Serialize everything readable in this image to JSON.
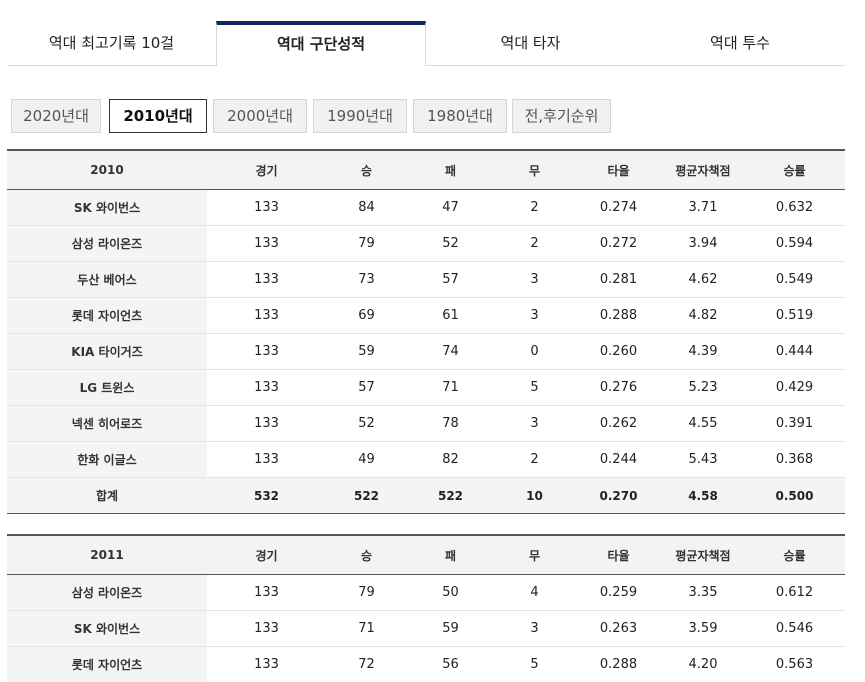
{
  "main_tabs": [
    {
      "label": "역대 최고기록 10걸",
      "active": false
    },
    {
      "label": "역대 구단성적",
      "active": true
    },
    {
      "label": "역대 타자",
      "active": false
    },
    {
      "label": "역대 투수",
      "active": false
    }
  ],
  "decades": [
    {
      "label": "2020년대",
      "active": false
    },
    {
      "label": "2010년대",
      "active": true
    },
    {
      "label": "2000년대",
      "active": false
    },
    {
      "label": "1990년대",
      "active": false
    },
    {
      "label": "1980년대",
      "active": false
    },
    {
      "label": "전,후기순위",
      "active": false
    }
  ],
  "columns": [
    "경기",
    "승",
    "패",
    "무",
    "타율",
    "평균자책점",
    "승률"
  ],
  "tables": [
    {
      "year": "2010",
      "rows": [
        [
          "SK 와이번스",
          "133",
          "84",
          "47",
          "2",
          "0.274",
          "3.71",
          "0.632"
        ],
        [
          "삼성 라이온즈",
          "133",
          "79",
          "52",
          "2",
          "0.272",
          "3.94",
          "0.594"
        ],
        [
          "두산 베어스",
          "133",
          "73",
          "57",
          "3",
          "0.281",
          "4.62",
          "0.549"
        ],
        [
          "롯데 자이언츠",
          "133",
          "69",
          "61",
          "3",
          "0.288",
          "4.82",
          "0.519"
        ],
        [
          "KIA 타이거즈",
          "133",
          "59",
          "74",
          "0",
          "0.260",
          "4.39",
          "0.444"
        ],
        [
          "LG 트윈스",
          "133",
          "57",
          "71",
          "5",
          "0.276",
          "5.23",
          "0.429"
        ],
        [
          "넥센 히어로즈",
          "133",
          "52",
          "78",
          "3",
          "0.262",
          "4.55",
          "0.391"
        ],
        [
          "한화 이글스",
          "133",
          "49",
          "82",
          "2",
          "0.244",
          "5.43",
          "0.368"
        ]
      ],
      "total": [
        "합계",
        "532",
        "522",
        "522",
        "10",
        "0.270",
        "4.58",
        "0.500"
      ]
    },
    {
      "year": "2011",
      "rows": [
        [
          "삼성 라이온즈",
          "133",
          "79",
          "50",
          "4",
          "0.259",
          "3.35",
          "0.612"
        ],
        [
          "SK 와이번스",
          "133",
          "71",
          "59",
          "3",
          "0.263",
          "3.59",
          "0.546"
        ],
        [
          "롯데 자이언츠",
          "133",
          "72",
          "56",
          "5",
          "0.288",
          "4.20",
          "0.563"
        ]
      ]
    }
  ]
}
